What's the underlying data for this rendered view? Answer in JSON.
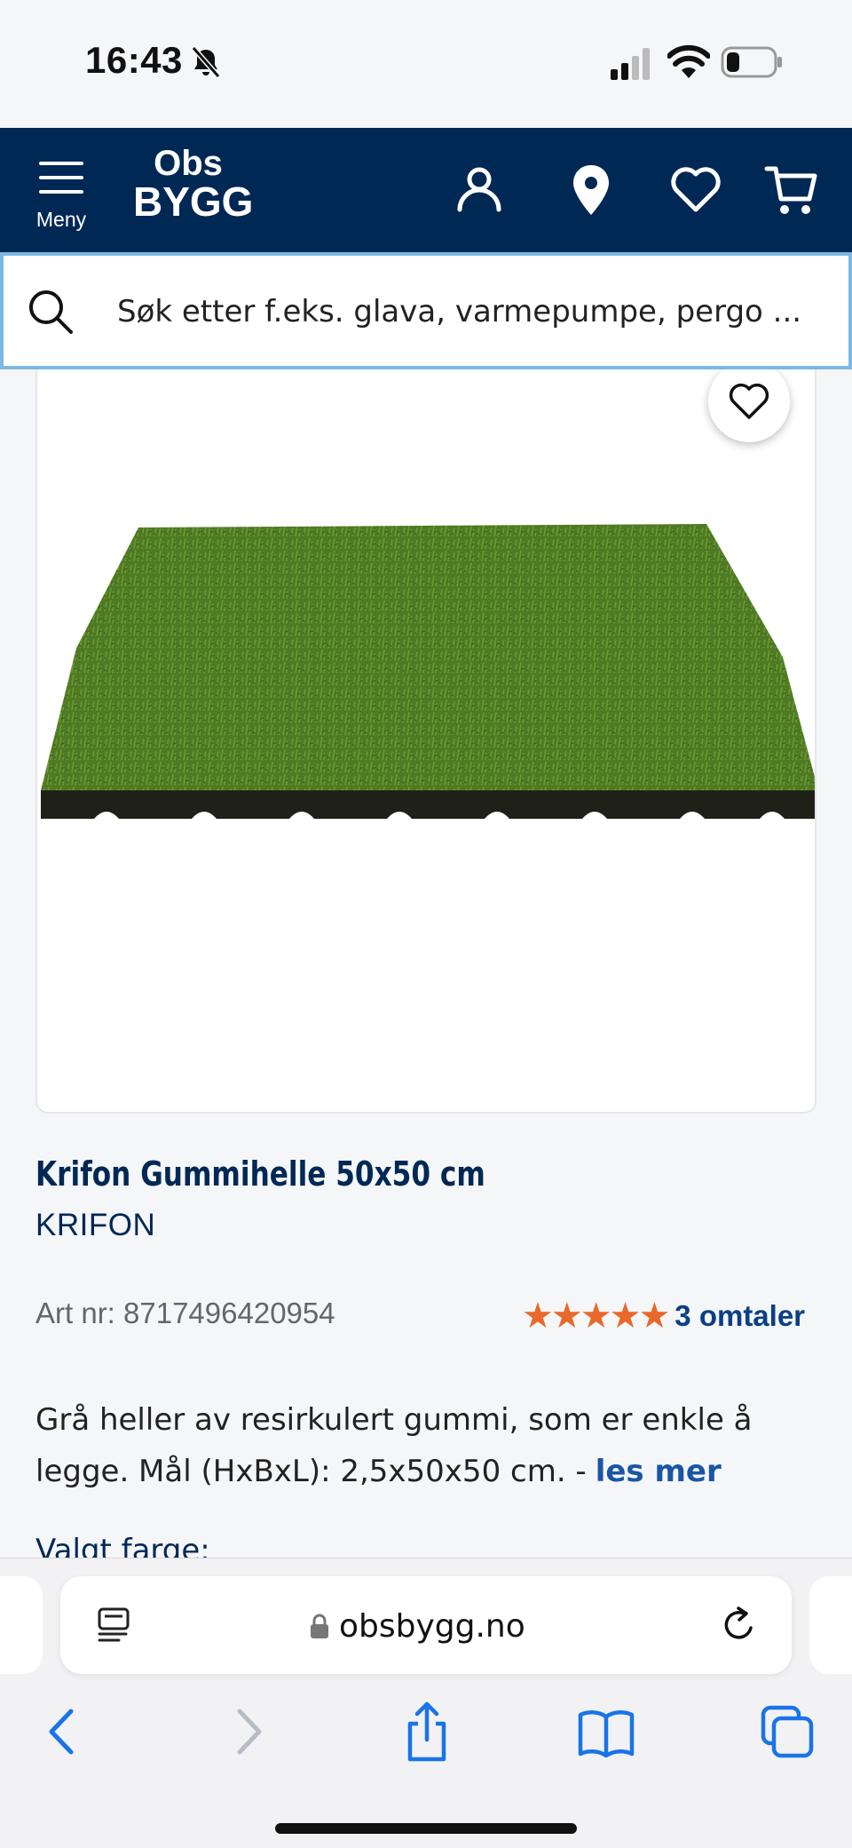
{
  "status_bar": {
    "time": "16:43"
  },
  "header": {
    "menu_label": "Meny",
    "logo_top": "Obs",
    "logo_bottom": "BYGG"
  },
  "search": {
    "placeholder": "Søk etter f.eks. glava, varmepumpe, pergo ..."
  },
  "product": {
    "title": "Krifon Gummihelle 50x50 cm",
    "brand": "KRIFON",
    "art_nr": "Art nr: 8717496420954",
    "rating_stars": "★★★★★",
    "rating": 5,
    "reviews": "3 omtaler",
    "description": "Grå heller av resirkulert gummi, som er enkle å legge. Mål (HxBxL): 2,5x50x50 cm. -",
    "read_more": "les mer",
    "color_label": "Valgt farge:"
  },
  "browser": {
    "url": "obsbygg.no"
  },
  "colors": {
    "navy": "#002855",
    "star": "#e9682b",
    "link": "#1a56a6",
    "search_border": "#7db7e3"
  }
}
